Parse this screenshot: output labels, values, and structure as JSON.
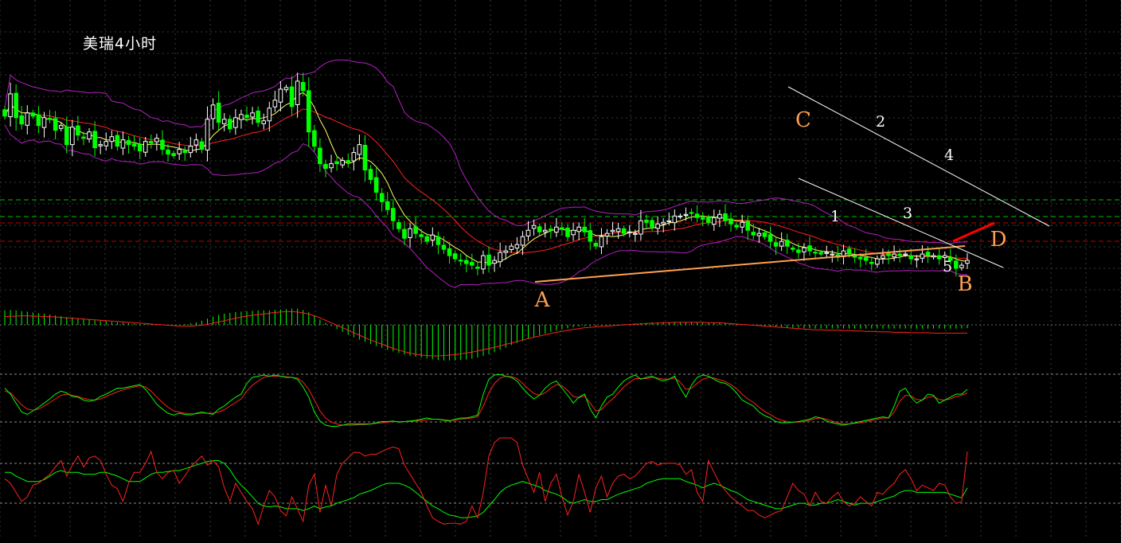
{
  "chart_data": {
    "type": "candlestick",
    "title": "美瑞4小时",
    "colors": {
      "background": "#000000",
      "bull_candle": "#ffffff",
      "bear_candle": "#00ff00",
      "ma_fast": "#ffff66",
      "ma_slow": "#ff2020",
      "bollinger": "#b020c0",
      "trend_line": "#ffa050",
      "short_trend": "#ff0000",
      "channel": "#ffffff",
      "grid": "#3a3a3a",
      "macd_hist": "#00ff00",
      "macd_signal": "#ff2020",
      "kdj_k": "#00ff00",
      "kdj_d": "#ff2020",
      "rsi_fast": "#ff2020",
      "rsi_slow": "#00ff00",
      "level_green": "#00c000",
      "level_red": "#c00000"
    },
    "price_panel": {
      "ylim": [
        20,
        0
      ],
      "close": [
        13.0,
        14.4,
        12.9,
        12.5,
        13.2,
        13.0,
        12.4,
        12.9,
        12.8,
        12.1,
        12.4,
        11.2,
        12.3,
        11.8,
        11.6,
        12.0,
        11.0,
        11.2,
        11.4,
        11.7,
        11.1,
        11.5,
        11.2,
        11.1,
        10.8,
        11.4,
        11.3,
        11.6,
        10.9,
        10.6,
        10.5,
        10.9,
        10.7,
        11.1,
        11.5,
        10.9,
        12.8,
        13.7,
        12.6,
        12.8,
        12.2,
        12.9,
        13.1,
        12.9,
        13.2,
        12.6,
        12.7,
        13.5,
        14.0,
        14.7,
        14.8,
        13.6,
        15.2,
        14.6,
        12.0,
        11.1,
        10.0,
        9.7,
        10.0,
        10.0,
        10.2,
        10.1,
        10.7,
        11.2,
        9.6,
        9.0,
        8.2,
        7.6,
        7.1,
        6.4,
        5.9,
        5.3,
        5.9,
        5.6,
        5.4,
        5.1,
        5.5,
        4.9,
        4.6,
        4.2,
        4.0,
        3.9,
        3.7,
        3.6,
        3.4,
        4.2,
        3.6,
        3.9,
        4.4,
        4.5,
        4.8,
        4.9,
        5.4,
        5.8,
        6.1,
        5.7,
        5.8,
        5.8,
        6.0,
        5.9,
        5.4,
        5.8,
        6.0,
        5.7,
        5.1,
        4.8,
        5.4,
        5.6,
        5.8,
        5.9,
        5.6,
        5.7,
        5.6,
        6.4,
        6.3,
        6.0,
        6.2,
        6.3,
        6.4,
        6.7,
        6.7,
        6.8,
        6.9,
        6.6,
        6.5,
        6.3,
        6.6,
        6.8,
        6.4,
        6.2,
        6.0,
        6.3,
        5.8,
        5.5,
        5.6,
        5.4,
        5.1,
        4.8,
        5.1,
        4.8,
        4.6,
        4.4,
        4.7,
        4.5,
        4.4,
        4.3,
        4.4,
        4.3,
        4.1,
        4.5,
        4.3,
        4.1,
        4.0,
        3.9,
        3.7,
        4.0,
        4.2,
        4.2,
        4.3,
        4.2,
        4.3,
        4.0,
        4.0,
        4.3,
        4.2,
        4.2,
        4.0,
        4.2,
        3.9,
        3.4,
        3.6,
        3.9
      ]
    },
    "annotations": {
      "A": "A",
      "B": "B",
      "C": "C",
      "D": "D",
      "wave_1": "1",
      "wave_2": "2",
      "wave_3": "3",
      "wave_4": "4",
      "wave_5": "5"
    },
    "macd": {
      "hist": [
        0.35,
        0.36,
        0.35,
        0.33,
        0.32,
        0.3,
        0.28,
        0.27,
        0.25,
        0.23,
        0.21,
        0.19,
        0.18,
        0.16,
        0.14,
        0.13,
        0.11,
        0.1,
        0.09,
        0.07,
        0.06,
        0.05,
        0.04,
        0.03,
        0.02,
        0.02,
        0.01,
        0.01,
        0.0,
        0.0,
        0.0,
        0.01,
        0.02,
        0.04,
        0.06,
        0.1,
        0.15,
        0.2,
        0.24,
        0.27,
        0.29,
        0.31,
        0.32,
        0.33,
        0.34,
        0.35,
        0.35,
        0.35,
        0.36,
        0.37,
        0.38,
        0.39,
        0.39,
        0.36,
        0.31,
        0.22,
        0.13,
        0.05,
        -0.03,
        -0.1,
        -0.17,
        -0.24,
        -0.3,
        -0.36,
        -0.41,
        -0.46,
        -0.51,
        -0.56,
        -0.6,
        -0.64,
        -0.68,
        -0.72,
        -0.75,
        -0.77,
        -0.79,
        -0.81,
        -0.83,
        -0.85,
        -0.86,
        -0.86,
        -0.86,
        -0.85,
        -0.84,
        -0.82,
        -0.79,
        -0.75,
        -0.71,
        -0.66,
        -0.6,
        -0.55,
        -0.49,
        -0.44,
        -0.39,
        -0.34,
        -0.29,
        -0.25,
        -0.21,
        -0.17,
        -0.14,
        -0.11,
        -0.08,
        -0.06,
        -0.04,
        -0.03,
        -0.03,
        -0.03,
        -0.02,
        -0.01,
        0.0,
        0.01,
        0.02,
        0.02,
        0.03,
        0.04,
        0.05,
        0.06,
        0.06,
        0.07,
        0.07,
        0.07,
        0.07,
        0.07,
        0.07,
        0.07,
        0.06,
        0.06,
        0.06,
        0.06,
        0.05,
        0.04,
        0.03,
        0.02,
        0.01,
        0.0,
        -0.01,
        -0.02,
        -0.03,
        -0.04,
        -0.05,
        -0.06,
        -0.07,
        -0.07,
        -0.08,
        -0.08,
        -0.09,
        -0.09,
        -0.09,
        -0.09,
        -0.09,
        -0.09,
        -0.09,
        -0.09,
        -0.09,
        -0.09,
        -0.09,
        -0.09,
        -0.09,
        -0.09,
        -0.09,
        -0.09,
        -0.09,
        -0.09,
        -0.09,
        -0.09,
        -0.09,
        -0.09,
        -0.09,
        -0.09,
        -0.09,
        -0.09,
        -0.09,
        -0.08
      ],
      "signal": [
        0.2,
        0.21,
        0.21,
        0.22,
        0.22,
        0.21,
        0.21,
        0.2,
        0.2,
        0.19,
        0.18,
        0.17,
        0.16,
        0.15,
        0.14,
        0.13,
        0.12,
        0.11,
        0.1,
        0.09,
        0.08,
        0.07,
        0.06,
        0.05,
        0.04,
        0.03,
        0.02,
        0.01,
        0.0,
        -0.01,
        -0.02,
        -0.03,
        -0.03,
        -0.03,
        -0.02,
        -0.01,
        0.01,
        0.04,
        0.07,
        0.1,
        0.13,
        0.16,
        0.19,
        0.21,
        0.23,
        0.25,
        0.26,
        0.28,
        0.3,
        0.31,
        0.32,
        0.32,
        0.31,
        0.29,
        0.26,
        0.22,
        0.17,
        0.11,
        0.05,
        -0.01,
        -0.07,
        -0.13,
        -0.19,
        -0.25,
        -0.31,
        -0.37,
        -0.42,
        -0.47,
        -0.52,
        -0.57,
        -0.61,
        -0.65,
        -0.68,
        -0.71,
        -0.73,
        -0.74,
        -0.75,
        -0.75,
        -0.74,
        -0.73,
        -0.72,
        -0.7,
        -0.68,
        -0.66,
        -0.63,
        -0.6,
        -0.57,
        -0.54,
        -0.51,
        -0.47,
        -0.44,
        -0.4,
        -0.37,
        -0.33,
        -0.3,
        -0.27,
        -0.24,
        -0.21,
        -0.18,
        -0.16,
        -0.13,
        -0.11,
        -0.09,
        -0.07,
        -0.06,
        -0.05,
        -0.04,
        -0.03,
        -0.02,
        -0.01,
        0.0,
        0.01,
        0.02,
        0.02,
        0.03,
        0.04,
        0.04,
        0.05,
        0.05,
        0.06,
        0.06,
        0.06,
        0.06,
        0.06,
        0.06,
        0.05,
        0.05,
        0.05,
        0.04,
        0.03,
        0.02,
        0.01,
        0.0,
        -0.01,
        -0.02,
        -0.03,
        -0.04,
        -0.05,
        -0.06,
        -0.07,
        -0.08,
        -0.09,
        -0.1,
        -0.11,
        -0.12,
        -0.12,
        -0.13,
        -0.13,
        -0.13,
        -0.14,
        -0.14,
        -0.15,
        -0.15,
        -0.16,
        -0.16,
        -0.17,
        -0.17,
        -0.17,
        -0.18,
        -0.18,
        -0.18,
        -0.19,
        -0.19,
        -0.19,
        -0.19,
        -0.2,
        -0.2,
        -0.2,
        -0.2,
        -0.2,
        -0.2,
        -0.2
      ]
    },
    "kdj": {
      "k": [
        70,
        60,
        45,
        30,
        26,
        32,
        38,
        45,
        52,
        60,
        65,
        62,
        56,
        55,
        50,
        48,
        50,
        56,
        60,
        65,
        70,
        70,
        72,
        74,
        76,
        68,
        56,
        43,
        35,
        28,
        25,
        28,
        26,
        25,
        28,
        30,
        28,
        26,
        35,
        40,
        48,
        55,
        60,
        78,
        88,
        90,
        92,
        90,
        92,
        90,
        88,
        88,
        85,
        72,
        55,
        30,
        15,
        8,
        6,
        6,
        8,
        10,
        10,
        10,
        10,
        10,
        12,
        14,
        14,
        15,
        13,
        14,
        15,
        16,
        18,
        20,
        18,
        18,
        16,
        15,
        18,
        20,
        20,
        22,
        25,
        60,
        85,
        92,
        93,
        90,
        88,
        82,
        70,
        60,
        52,
        58,
        70,
        78,
        82,
        70,
        58,
        45,
        55,
        60,
        35,
        20,
        40,
        55,
        60,
        72,
        82,
        88,
        92,
        85,
        88,
        90,
        85,
        82,
        85,
        90,
        70,
        55,
        75,
        88,
        92,
        90,
        85,
        80,
        78,
        72,
        62,
        50,
        45,
        40,
        30,
        24,
        20,
        14,
        12,
        12,
        13,
        14,
        16,
        18,
        22,
        20,
        15,
        12,
        10,
        8,
        10,
        12,
        14,
        16,
        18,
        20,
        22,
        20,
        40,
        65,
        70,
        55,
        45,
        50,
        60,
        58,
        45,
        50,
        55,
        60,
        60,
        68
      ],
      "d": [
        65,
        62,
        52,
        42,
        35,
        33,
        35,
        40,
        46,
        52,
        58,
        60,
        58,
        56,
        53,
        51,
        50,
        52,
        56,
        60,
        64,
        67,
        70,
        72,
        74,
        72,
        65,
        55,
        46,
        38,
        32,
        30,
        28,
        27,
        27,
        28,
        28,
        28,
        30,
        34,
        40,
        46,
        52,
        65,
        75,
        82,
        88,
        90,
        90,
        90,
        89,
        88,
        87,
        80,
        68,
        50,
        32,
        20,
        13,
        10,
        8,
        8,
        8,
        9,
        9,
        10,
        11,
        12,
        13,
        14,
        14,
        14,
        14,
        15,
        16,
        17,
        18,
        18,
        17,
        16,
        16,
        18,
        19,
        20,
        22,
        40,
        62,
        78,
        87,
        90,
        89,
        86,
        78,
        69,
        61,
        58,
        62,
        70,
        76,
        74,
        66,
        56,
        54,
        57,
        45,
        32,
        34,
        44,
        52,
        62,
        72,
        80,
        86,
        86,
        86,
        88,
        87,
        85,
        85,
        87,
        80,
        68,
        70,
        78,
        85,
        88,
        87,
        84,
        81,
        76,
        69,
        60,
        52,
        46,
        38,
        31,
        26,
        20,
        16,
        14,
        13,
        13,
        14,
        16,
        19,
        20,
        18,
        15,
        12,
        10,
        10,
        11,
        12,
        14,
        16,
        18,
        20,
        20,
        30,
        48,
        58,
        57,
        51,
        50,
        55,
        56,
        51,
        50,
        52,
        56,
        58,
        62
      ]
    },
    "rsi": {
      "fast": [
        55,
        50,
        40,
        30,
        35,
        48,
        50,
        55,
        60,
        68,
        75,
        58,
        70,
        80,
        68,
        78,
        80,
        75,
        60,
        48,
        44,
        30,
        50,
        62,
        62,
        72,
        85,
        62,
        55,
        62,
        64,
        50,
        58,
        68,
        74,
        80,
        70,
        75,
        68,
        45,
        30,
        50,
        40,
        30,
        22,
        5,
        25,
        42,
        35,
        20,
        14,
        35,
        22,
        8,
        48,
        60,
        18,
        48,
        25,
        60,
        72,
        78,
        84,
        84,
        80,
        82,
        82,
        85,
        88,
        90,
        88,
        70,
        60,
        50,
        40,
        25,
        12,
        8,
        5,
        6,
        6,
        5,
        8,
        25,
        12,
        40,
        80,
        95,
        100,
        100,
        100,
        95,
        70,
        55,
        40,
        62,
        30,
        50,
        60,
        35,
        15,
        30,
        60,
        40,
        18,
        45,
        58,
        35,
        50,
        58,
        60,
        55,
        58,
        65,
        72,
        74,
        70,
        72,
        72,
        72,
        70,
        60,
        65,
        40,
        30,
        75,
        62,
        50,
        42,
        35,
        30,
        25,
        20,
        20,
        15,
        12,
        15,
        18,
        20,
        35,
        50,
        42,
        38,
        25,
        40,
        30,
        28,
        35,
        40,
        30,
        25,
        28,
        35,
        30,
        25,
        40,
        38,
        45,
        50,
        60,
        65,
        55,
        42,
        48,
        45,
        42,
        50,
        48,
        35,
        28,
        30,
        85
      ],
      "slow": [
        62,
        62,
        58,
        55,
        52,
        52,
        52,
        54,
        58,
        62,
        64,
        62,
        62,
        62,
        60,
        60,
        60,
        62,
        62,
        60,
        58,
        55,
        52,
        52,
        52,
        56,
        60,
        62,
        62,
        63,
        64,
        64,
        66,
        68,
        70,
        72,
        74,
        75,
        75,
        72,
        65,
        55,
        48,
        42,
        35,
        28,
        25,
        24,
        25,
        24,
        22,
        22,
        22,
        20,
        22,
        25,
        22,
        24,
        25,
        28,
        30,
        32,
        34,
        38,
        40,
        42,
        45,
        48,
        50,
        50,
        50,
        48,
        45,
        40,
        35,
        30,
        25,
        22,
        18,
        15,
        14,
        12,
        12,
        13,
        14,
        18,
        25,
        32,
        40,
        45,
        48,
        50,
        52,
        50,
        48,
        46,
        42,
        40,
        38,
        35,
        30,
        28,
        30,
        32,
        30,
        30,
        32,
        32,
        35,
        38,
        40,
        42,
        44,
        46,
        50,
        52,
        54,
        55,
        55,
        55,
        55,
        52,
        50,
        48,
        45,
        48,
        50,
        48,
        45,
        42,
        40,
        36,
        32,
        30,
        28,
        26,
        24,
        22,
        22,
        24,
        26,
        28,
        28,
        26,
        26,
        28,
        28,
        30,
        32,
        30,
        28,
        26,
        28,
        28,
        28,
        30,
        32,
        34,
        36,
        40,
        42,
        42,
        40,
        40,
        40,
        40,
        40,
        40,
        38,
        36,
        34,
        45
      ]
    }
  }
}
